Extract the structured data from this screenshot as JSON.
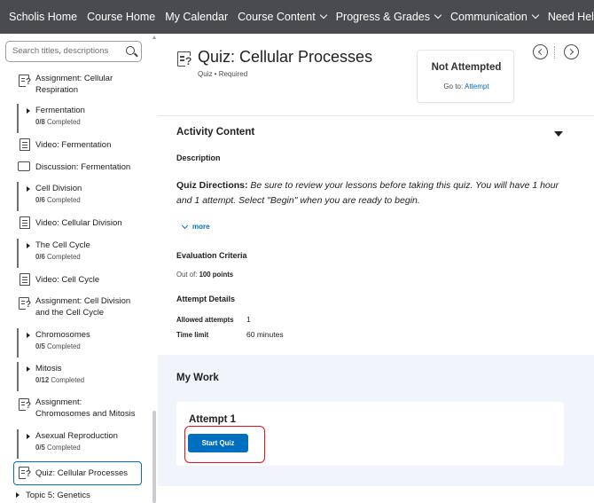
{
  "topnav": {
    "items": [
      {
        "label": "Scholis Home",
        "dropdown": false
      },
      {
        "label": "Course Home",
        "dropdown": false
      },
      {
        "label": "My Calendar",
        "dropdown": false
      },
      {
        "label": "Course Content",
        "dropdown": true
      },
      {
        "label": "Progress & Grades",
        "dropdown": true
      },
      {
        "label": "Communication",
        "dropdown": true
      },
      {
        "label": "Need Help?",
        "dropdown": true
      }
    ],
    "bg_color": "#4a4b4f"
  },
  "sidebar": {
    "search_placeholder": "Search titles, descriptions",
    "items": [
      {
        "type": "assignment",
        "label": "Assignment: Cellular Respiration"
      },
      {
        "type": "module",
        "label": "Fermentation",
        "completed": "0/8",
        "suffix": "Completed"
      },
      {
        "type": "document",
        "label": "Video: Fermentation"
      },
      {
        "type": "discussion",
        "label": "Discussion: Fermentation"
      },
      {
        "type": "module",
        "label": "Cell Division",
        "completed": "0/6",
        "suffix": "Completed"
      },
      {
        "type": "document",
        "label": "Video: Cellular Division"
      },
      {
        "type": "module",
        "label": "The Cell Cycle",
        "completed": "0/6",
        "suffix": "Completed"
      },
      {
        "type": "document",
        "label": "Video: Cell Cycle"
      },
      {
        "type": "assignment",
        "label": "Assignment: Cell Division and the Cell Cycle"
      },
      {
        "type": "module",
        "label": "Chromosomes",
        "completed": "0/5",
        "suffix": "Completed"
      },
      {
        "type": "module",
        "label": "Mitosis",
        "completed": "0/12",
        "suffix": "Completed"
      },
      {
        "type": "assignment",
        "label": "Assignment: Chromosomes and Mitosis"
      },
      {
        "type": "module",
        "label": "Asexual Reproduction",
        "completed": "0/5",
        "suffix": "Completed"
      },
      {
        "type": "quiz",
        "label": "Quiz: Cellular Processes",
        "selected": true
      },
      {
        "type": "topic",
        "label": "Topic 5: Genetics"
      }
    ]
  },
  "header": {
    "title": "Quiz: Cellular Processes",
    "meta": "Quiz • Required",
    "status": "Not Attempted",
    "goto_prefix": "Go to:",
    "goto_link": "Attempt"
  },
  "content": {
    "section_title": "Activity Content",
    "description_label": "Description",
    "directions_bold": "Quiz Directions:",
    "directions_text": " Be sure to review your lessons before taking this quiz. You will have 1 hour and 1 attempt. Select \"Begin\" when you are ready to begin.",
    "more_label": "more",
    "evaluation_title": "Evaluation Criteria",
    "out_of_label": "Out of:",
    "out_of_value": "100 points",
    "attempt_details_title": "Attempt Details",
    "allowed_attempts_label": "Allowed attempts",
    "allowed_attempts_value": "1",
    "time_limit_label": "Time limit",
    "time_limit_value": "60 minutes"
  },
  "mywork": {
    "title": "My Work",
    "attempt_title": "Attempt 1",
    "start_button": "Start Quiz"
  },
  "colors": {
    "accent": "#006fbf",
    "highlight": "#e0101e",
    "main_bg": "#f1f5fb"
  }
}
